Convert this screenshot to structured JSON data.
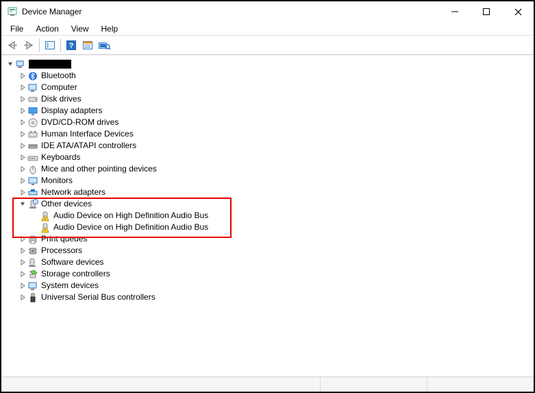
{
  "window": {
    "title": "Device Manager"
  },
  "menu": {
    "file": "File",
    "action": "Action",
    "view": "View",
    "help": "Help"
  },
  "toolbar": {
    "back": "Back",
    "forward": "Forward",
    "show_hide_tree": "Show/Hide Console Tree",
    "help": "Help",
    "properties": "Properties",
    "scan": "Scan for hardware changes"
  },
  "tree": {
    "root_name": "",
    "items": [
      {
        "label": "Bluetooth",
        "icon": "bluetooth"
      },
      {
        "label": "Computer",
        "icon": "computer"
      },
      {
        "label": "Disk drives",
        "icon": "disk"
      },
      {
        "label": "Display adapters",
        "icon": "display"
      },
      {
        "label": "DVD/CD-ROM drives",
        "icon": "dvd"
      },
      {
        "label": "Human Interface Devices",
        "icon": "hid"
      },
      {
        "label": "IDE ATA/ATAPI controllers",
        "icon": "ide"
      },
      {
        "label": "Keyboards",
        "icon": "keyboard"
      },
      {
        "label": "Mice and other pointing devices",
        "icon": "mouse"
      },
      {
        "label": "Monitors",
        "icon": "monitor"
      },
      {
        "label": "Network adapters",
        "icon": "network"
      },
      {
        "label": "Other devices",
        "icon": "other",
        "expanded": true,
        "children": [
          {
            "label": "Audio Device on High Definition Audio Bus",
            "icon": "warn"
          },
          {
            "label": "Audio Device on High Definition Audio Bus",
            "icon": "warn"
          }
        ]
      },
      {
        "label": "Print queues",
        "icon": "printer"
      },
      {
        "label": "Processors",
        "icon": "cpu"
      },
      {
        "label": "Software devices",
        "icon": "software"
      },
      {
        "label": "Storage controllers",
        "icon": "storage"
      },
      {
        "label": "System devices",
        "icon": "system"
      },
      {
        "label": "Universal Serial Bus controllers",
        "icon": "usb"
      }
    ]
  }
}
